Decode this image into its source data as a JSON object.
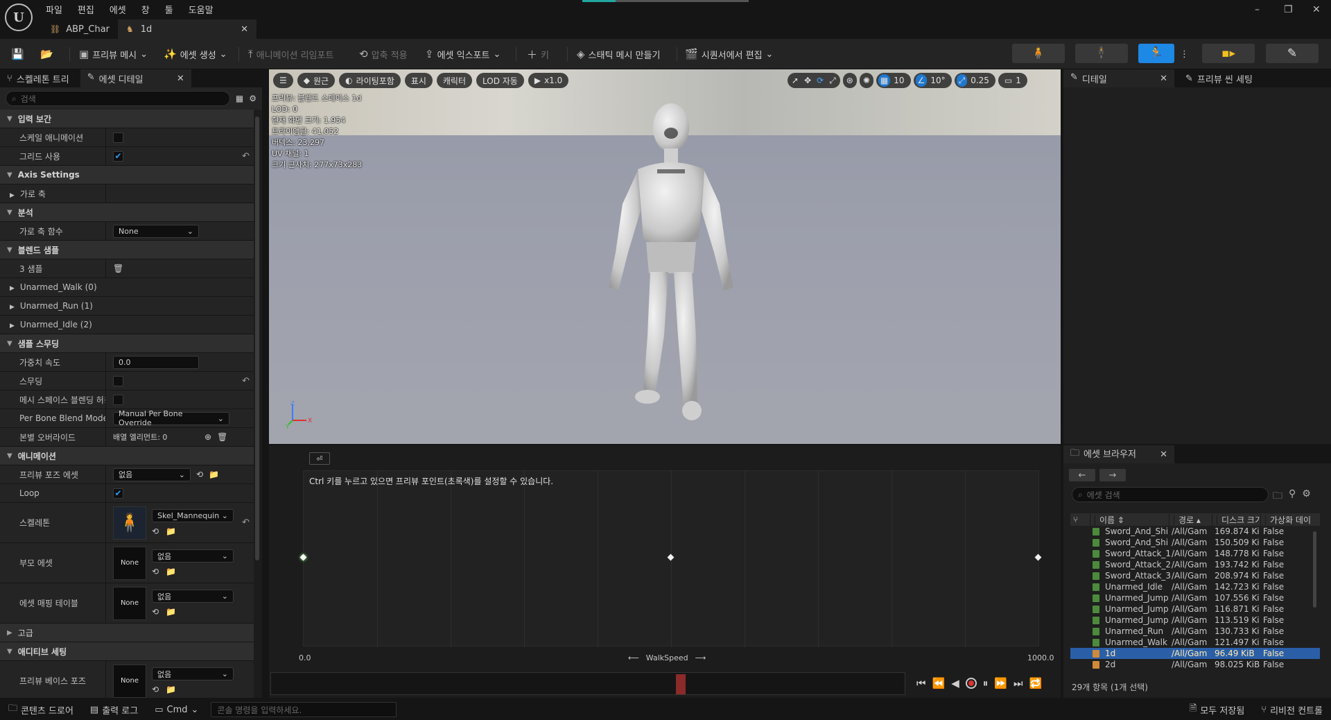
{
  "menu": [
    "파일",
    "편집",
    "에셋",
    "창",
    "툴",
    "도움말"
  ],
  "doc_tabs": [
    {
      "label": "ABP_Char",
      "active": false
    },
    {
      "label": "1d",
      "active": true
    }
  ],
  "window_controls": [
    "–",
    "❐",
    "✕"
  ],
  "toolbar": {
    "preview_mesh": "프리뷰 메시",
    "create_asset": "에셋 생성",
    "anim_retarget": "애니메이션 리임포트",
    "apply_compression": "압축 적용",
    "asset_export": "에셋 익스포트",
    "key": "키",
    "make_static_mesh": "스태틱 메시 만들기",
    "edit_in_sequencer": "시퀀서에서 편집"
  },
  "left_tabs": {
    "skeleton_tree": "스켈레톤 트리",
    "asset_details": "에셋 디테일"
  },
  "search_placeholder": "검색",
  "details": {
    "input_interp": "입력 보간",
    "scale_anim": "스케일 애니메이션",
    "use_grid": "그리드 사용",
    "axis_settings": "Axis Settings",
    "horizontal_axis": "가로 축",
    "analysis": "분석",
    "horiz_axis_func": "가로 축 함수",
    "horiz_axis_func_val": "None",
    "blend_samples": "블렌드 샘플",
    "sample_count": "3 샘플",
    "samples": [
      "Unarmed_Walk (0)",
      "Unarmed_Run (1)",
      "Unarmed_Idle (2)"
    ],
    "sample_smoothing": "샘플 스무딩",
    "weight_speed": "가중치 속도",
    "weight_speed_val": "0.0",
    "smoothing": "스무딩",
    "mesh_space_blend": "메시 스페이스 블렌딩 허용",
    "per_bone_blend_mode": "Per Bone Blend Mode",
    "per_bone_blend_mode_val": "Manual Per Bone Override",
    "per_bone_override": "본별 오버라이드",
    "array_elements": "배열 엘리먼트: 0",
    "animation": "애니메이션",
    "preview_pose_asset": "프리뷰 포즈 에셋",
    "none_kr": "없음",
    "loop": "Loop",
    "skeleton": "스켈레톤",
    "skeleton_val": "Skel_Mannequin",
    "parent_asset": "부모 에셋",
    "none_en": "None",
    "asset_mapping_table": "에셋 매핑 테이블",
    "advanced": "고급",
    "additive_settings": "애디티브 세팅",
    "preview_base_pose": "프리뷰 베이스 포즈"
  },
  "viewport": {
    "tools": [
      "원근",
      "라이팅포함",
      "표시",
      "캐릭터",
      "LOD 자동",
      "x1.0"
    ],
    "right_tools": [
      "10",
      "10°",
      "0.25",
      "1"
    ],
    "stats": [
      "프리뷰: 블렌드 스페이스 1d",
      "LOD: 0",
      "현재 화면 크기: 1.954",
      "트라이앵글: 41,052",
      "버텍스: 23,297",
      "UV 채널: 1",
      "크기 근사치: 277x73x283"
    ],
    "axis_labels": {
      "x": "X",
      "y": "Y",
      "z": "Z"
    }
  },
  "right_tabs": {
    "details": "디테일",
    "preview_scene": "프리뷰 씬 세팅"
  },
  "graph": {
    "hint": "Ctrl 키를 누르고 있으면 프리뷰 포인트(초록색)를 설정할 수 있습니다.",
    "axis_min": "0.0",
    "axis_max": "1000.0",
    "axis_name": "WalkSpeed",
    "sample_points": [
      0,
      500,
      1000
    ]
  },
  "content_browser": {
    "title": "에셋 브라우저",
    "search_placeholder": "에셋 검색",
    "columns": [
      "이름",
      "경로",
      "디스크 크기",
      "가상화 데이"
    ],
    "rows": [
      [
        "Sword_And_Shi",
        "/All/Gam",
        "169.874 Ki",
        "False"
      ],
      [
        "Sword_And_Shi",
        "/All/Gam",
        "150.509 Ki",
        "False"
      ],
      [
        "Sword_Attack_1",
        "/All/Gam",
        "148.778 Ki",
        "False"
      ],
      [
        "Sword_Attack_2",
        "/All/Gam",
        "193.742 Ki",
        "False"
      ],
      [
        "Sword_Attack_3",
        "/All/Gam",
        "208.974 Ki",
        "False"
      ],
      [
        "Unarmed_Idle",
        "/All/Gam",
        "142.723 Ki",
        "False"
      ],
      [
        "Unarmed_Jump",
        "/All/Gam",
        "107.556 Ki",
        "False"
      ],
      [
        "Unarmed_Jump",
        "/All/Gam",
        "116.871 Ki",
        "False"
      ],
      [
        "Unarmed_Jump",
        "/All/Gam",
        "113.519 Ki",
        "False"
      ],
      [
        "Unarmed_Run",
        "/All/Gam",
        "130.733 Ki",
        "False"
      ],
      [
        "Unarmed_Walk",
        "/All/Gam",
        "121.497 Ki",
        "False"
      ],
      [
        "1d",
        "/All/Gam",
        "96.49 KiB",
        "False"
      ],
      [
        "2d",
        "/All/Gam",
        "98.025 KiB",
        "False"
      ]
    ],
    "selected_index": 11,
    "count": "29개 항목 (1개 선택)"
  },
  "statusbar": {
    "content_drawer": "콘텐츠 드로어",
    "output_log": "출력 로그",
    "cmd": "Cmd",
    "console_placeholder": "콘솔 명령을 입력하세요.",
    "save_all": "모두 저장됨",
    "revision_control": "리비전 컨트롤"
  }
}
